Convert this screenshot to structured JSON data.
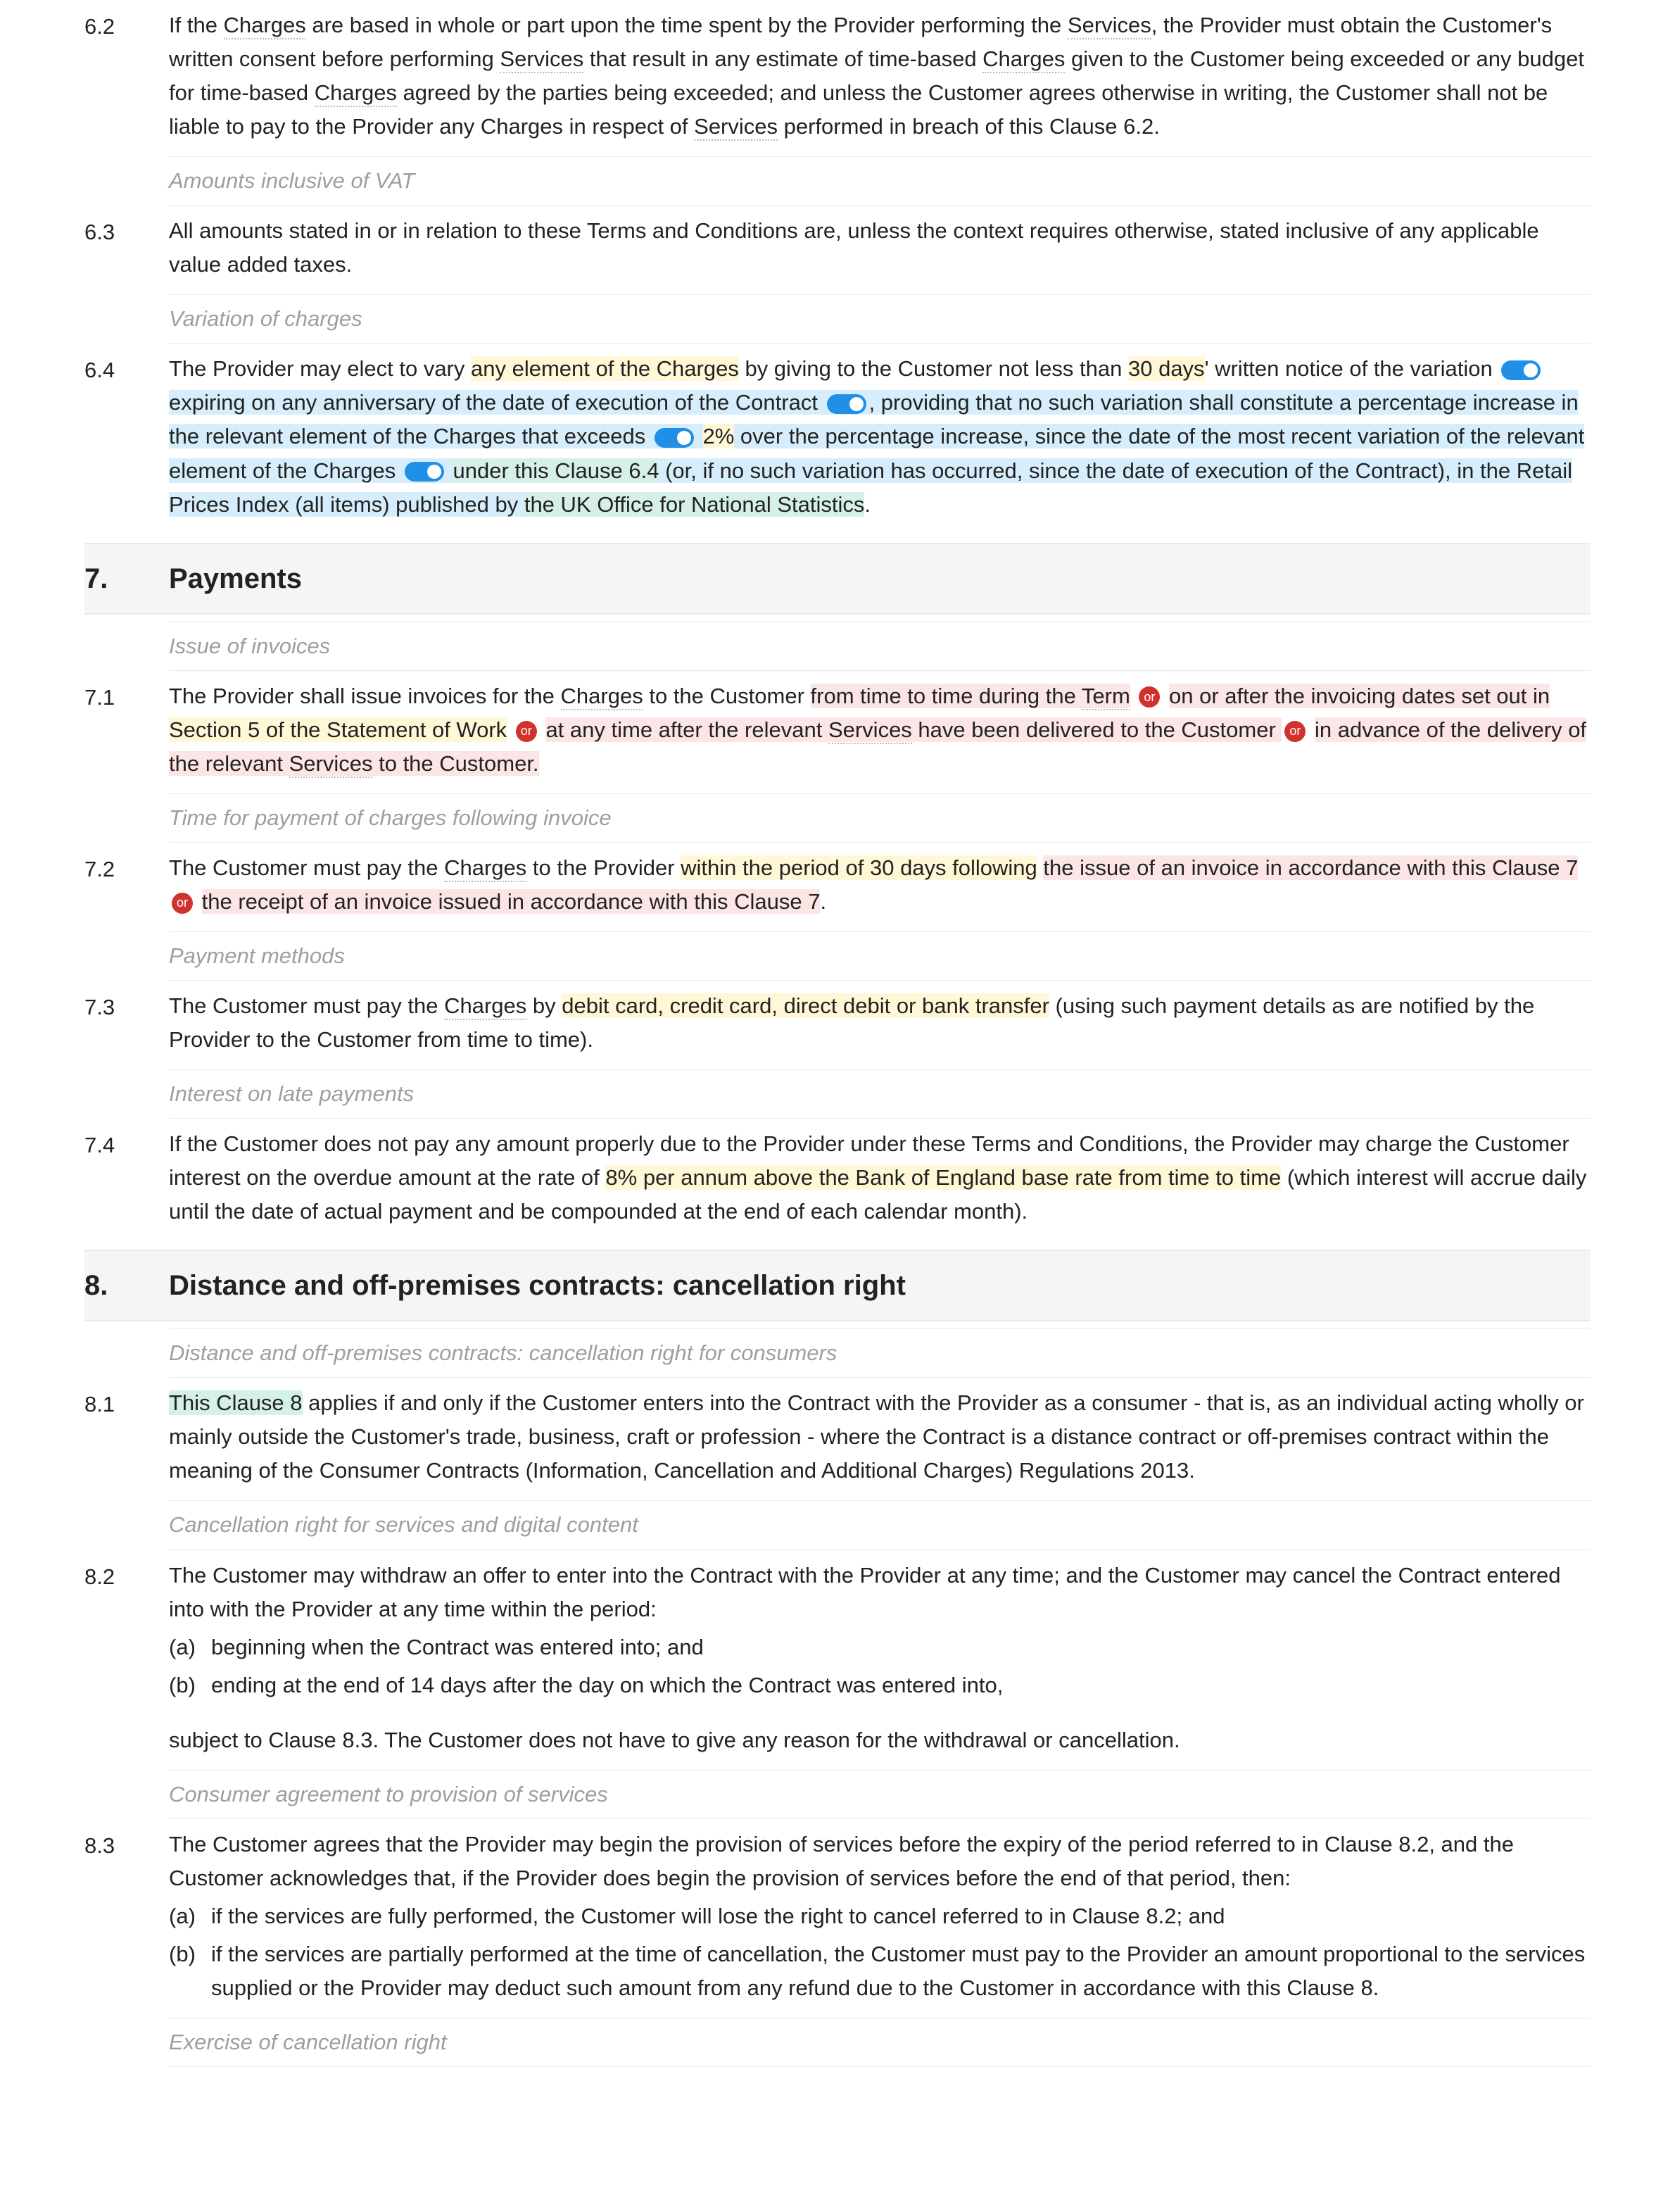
{
  "badge_or": "or",
  "c62": {
    "num": "6.2",
    "t1": "If the ",
    "t2": "Charges",
    "t3": " are based in whole or part upon the time spent by the Provider performing the ",
    "t4": "Services",
    "t5": ", the Provider must obtain the Customer's written consent before performing ",
    "t6": "Services",
    "t7": " that result in any estimate of time-based ",
    "t8": "Charges",
    "t9": " given to the Customer being exceeded or any budget for time-based ",
    "t10": "Charges",
    "t11": " agreed by the parties being exceeded; and unless the Customer agrees otherwise in writing, the Customer shall not be liable to pay to the Provider any Charges in respect of ",
    "t12": "Services",
    "t13": " performed in breach of this Clause 6.2."
  },
  "n62": "Amounts inclusive of VAT",
  "c63": {
    "num": "6.3",
    "text": "All amounts stated in or in relation to these Terms and Conditions are, unless the context requires otherwise, stated inclusive of any applicable value added taxes."
  },
  "n63": "Variation of charges",
  "c64": {
    "num": "6.4",
    "t1": "The Provider may elect to vary ",
    "t2": "any element of the Charges",
    "t3": " by giving to the Customer not less than ",
    "t4": "30 days",
    "t5": "' written notice of the variation ",
    "t6": "expiring on any anniversary of the date of execution of the Contract",
    "t7": ", providing that no such variation shall constitute a percentage increase in the relevant element of the Charges that exceeds ",
    "t8": "2%",
    "t9": " over the percentage increase, since the date of the most recent variation of the relevant element of the Charges ",
    "t10": "under this Clause 6.4",
    "t11": " (or, if no such variation has occurred, since the date of execution of the Contract), in the Retail Prices Index (all items) published by ",
    "t12": "the UK Office for National Statistics",
    "t13": "."
  },
  "s7": {
    "num": "7.",
    "title": "Payments"
  },
  "n70": "Issue of invoices",
  "c71": {
    "num": "7.1",
    "t1": "The Provider shall issue invoices for the ",
    "t2": "Charges",
    "t3": " to the Customer ",
    "t4": "from time to time during the ",
    "t4b": "Term",
    "t5": " on or after the invoicing dates set out in ",
    "t6": "Section 5 of the Statement of Work",
    "t7": " at any time after the relevant ",
    "t7b": "Services",
    "t7c": " have been delivered to the Customer ",
    "t8": " in advance of the delivery of the relevant ",
    "t8b": "Services",
    "t8c": " to the Customer."
  },
  "n71": "Time for payment of charges following invoice",
  "c72": {
    "num": "7.2",
    "t1": "The Customer must pay the ",
    "t2": "Charges",
    "t3": " to the Provider ",
    "t4": "within the period of 30 days following",
    "t5a": " the issue of an invoice in accordance with this Clause 7 ",
    "t5b": " the receipt of an invoice issued in accordance with this Clause 7",
    "t6": "."
  },
  "n72": "Payment methods",
  "c73": {
    "num": "7.3",
    "t1": "The Customer must pay the ",
    "t2": "Charges",
    "t3": " by ",
    "t4": "debit card, credit card, direct debit or bank transfer",
    "t5": " (using such payment details as are notified by the Provider to the Customer from time to time)."
  },
  "n73": "Interest on late payments",
  "c74": {
    "num": "7.4",
    "t1": "If the Customer does not pay any amount properly due to the Provider under these Terms and Conditions, the Provider may charge the Customer interest on the overdue amount at the rate of ",
    "t2": "8% per annum above the Bank of England base rate from time to time",
    "t3": " (which interest will accrue daily until the date of actual payment and be compounded at the end of each calendar month)."
  },
  "s8": {
    "num": "8.",
    "title": "Distance and off-premises contracts: cancellation right"
  },
  "n80": "Distance and off-premises contracts: cancellation right for consumers",
  "c81": {
    "num": "8.1",
    "t1": "This Clause 8",
    "t2": " applies if and only if the Customer enters into the Contract with the Provider as a consumer - that is, as an individual acting wholly or mainly outside the Customer's trade, business, craft or profession - where the Contract is a distance contract or off-premises contract within the meaning of the Consumer Contracts (Information, Cancellation and Additional Charges) Regulations 2013."
  },
  "n81": "Cancellation right for services and digital content",
  "c82": {
    "num": "8.2",
    "t1": "The Customer may withdraw an offer to enter into the Contract with the Provider at any time; and the Customer may cancel the Contract entered into with the Provider at any time within the period:",
    "a_n": "(a)",
    "a": "beginning when the Contract was entered into; and",
    "b_n": "(b)",
    "b": "ending at the end of 14 days after the day on which the Contract was entered into,",
    "t2": "subject to Clause 8.3. The Customer does not have to give any reason for the withdrawal or cancellation."
  },
  "n82": "Consumer agreement to provision of services",
  "c83": {
    "num": "8.3",
    "t1": "The Customer agrees that the Provider may begin the provision of services before the expiry of the period referred to in Clause 8.2, and the Customer acknowledges that, if the Provider does begin the provision of services before the end of that period, then:",
    "a_n": "(a)",
    "a": "if the services are fully performed, the Customer will lose the right to cancel referred to in Clause 8.2; and",
    "b_n": "(b)",
    "b": "if the services are partially performed at the time of cancellation, the Customer must pay to the Provider an amount proportional to the services supplied or the Provider may deduct such amount from any refund due to the Customer in accordance with this Clause 8."
  },
  "n83": "Exercise of cancellation right"
}
